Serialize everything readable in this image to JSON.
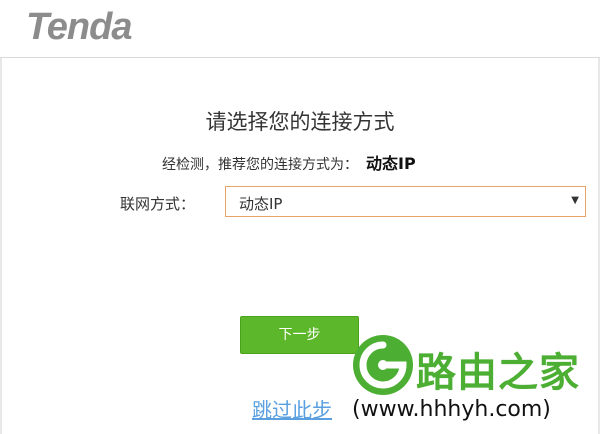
{
  "header": {
    "logo_text": "Tenda"
  },
  "wizard": {
    "title": "请选择您的连接方式",
    "detect_prefix": "经检测，推荐您的连接方式为：",
    "detect_result": "动态IP",
    "connection_label": "联网方式：",
    "connection_value": "动态IP",
    "next_label": "下一步",
    "skip_label": "跳过此步"
  },
  "watermark": {
    "brand_cn": "路由之家",
    "url": "(www.hhhyh.com)"
  },
  "colors": {
    "accent_green": "#5cb82a",
    "link_blue": "#5aa0e0",
    "select_border": "#e6a46a",
    "logo_gray": "#8c8c8c",
    "watermark_green": "#4caf33"
  },
  "icons": {
    "select_arrow": "chevron-down-icon",
    "watermark": "router-home-logo-icon"
  }
}
